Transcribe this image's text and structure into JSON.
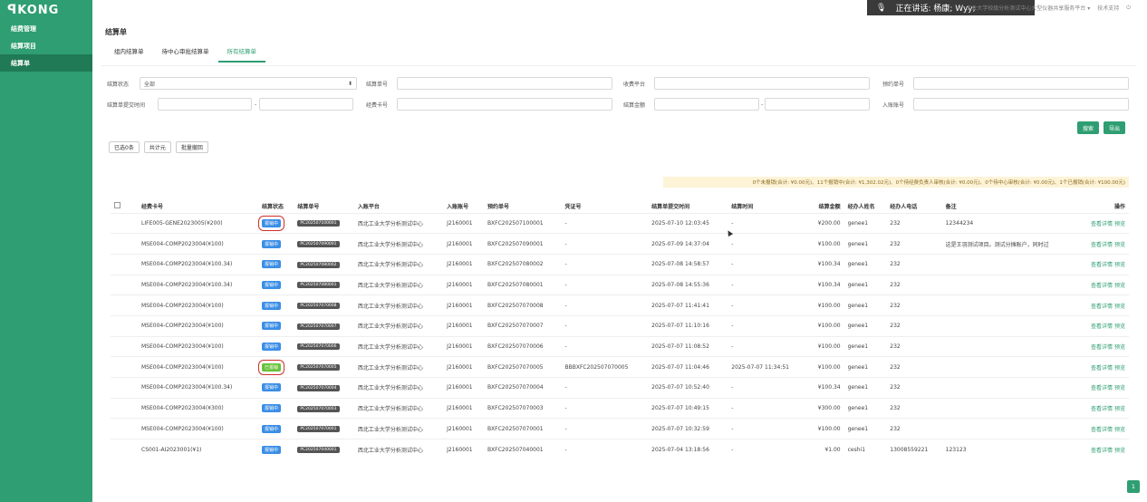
{
  "app": {
    "logo": "KONG"
  },
  "sidebar": {
    "items": [
      {
        "label": "结费管理"
      },
      {
        "label": "结算项目"
      },
      {
        "label": "结算单"
      }
    ]
  },
  "topbar": {
    "toast": "正在讲话: 杨康; Wyy;",
    "org": "工业大学校级分析测试中心大型仪器共享服务平台",
    "support": "技术支持"
  },
  "page": {
    "title": "结算单"
  },
  "tabs": [
    {
      "label": "组内结算单"
    },
    {
      "label": "待中心审批结算单"
    },
    {
      "label": "所有结算单"
    }
  ],
  "filters": {
    "status_label": "结算状态",
    "status_value": "全部",
    "bill_no_label": "结算单号",
    "platform_label": "收费平台",
    "booking_no_label": "预约单号",
    "submit_time_label": "结算单提交时间",
    "card_no_label": "经费卡号",
    "amount_label": "结算金额",
    "account_label": "入账账号",
    "range_sep": "-"
  },
  "actions": {
    "search": "搜索",
    "export": "导出",
    "selected": "已选0条",
    "total": "共计元",
    "batch_withdraw": "批量撤回"
  },
  "summary": "0个未报销(合计: ¥0.00元)、11个报销中(合计: ¥1,302.02元)、0个待经费负责人审核(合计: ¥0.00元)、0个待中心审核(合计: ¥0.00元)、1个已报销(合计: ¥100.00元)",
  "table": {
    "headers": [
      "经费卡号",
      "结算状态",
      "结算单号",
      "入账平台",
      "入账账号",
      "预约单号",
      "凭证号",
      "结算单提交时间",
      "结算时间",
      "结算金额",
      "经办人姓名",
      "经办人电话",
      "备注",
      "操作"
    ],
    "rows": [
      {
        "card": "LIFE005-GENE2023005(¥200)",
        "status": "报销中",
        "code": "PC202507100001",
        "platform": "西北工业大学分析测试中心",
        "account": "J2160001",
        "booking": "BXFC202507100001",
        "voucher": "-",
        "submit": "2025-07-10 12:03:45",
        "settle": "-",
        "amount": "¥200.00",
        "handler": "genee1",
        "phone": "232",
        "remark": "12344234",
        "op1": "查看详情",
        "op2": "预览"
      },
      {
        "card": "MSE004-COMP2023004(¥100)",
        "status": "报销中",
        "code": "PC202507090001",
        "platform": "西北工业大学分析测试中心",
        "account": "J2160001",
        "booking": "BXFC202507090001",
        "voucher": "-",
        "submit": "2025-07-09 14:37:04",
        "settle": "-",
        "amount": "¥100.00",
        "handler": "genee1",
        "phone": "232",
        "remark": "这是王羽测试项目。测试分摊账户，同时过",
        "op1": "查看详情",
        "op2": "预览"
      },
      {
        "card": "MSE004-COMP2023004(¥100.34)",
        "status": "报销中",
        "code": "PC202507080002",
        "platform": "西北工业大学分析测试中心",
        "account": "J2160001",
        "booking": "BXFC202507080002",
        "voucher": "-",
        "submit": "2025-07-08 14:58:57",
        "settle": "-",
        "amount": "¥100.34",
        "handler": "genee1",
        "phone": "232",
        "remark": "",
        "op1": "查看详情",
        "op2": "预览"
      },
      {
        "card": "MSE004-COMP2023004(¥100.34)",
        "status": "报销中",
        "code": "PC202507080001",
        "platform": "西北工业大学分析测试中心",
        "account": "J2160001",
        "booking": "BXFC202507080001",
        "voucher": "-",
        "submit": "2025-07-08 14:55:36",
        "settle": "-",
        "amount": "¥100.34",
        "handler": "genee1",
        "phone": "232",
        "remark": "",
        "op1": "查看详情",
        "op2": "预览"
      },
      {
        "card": "MSE004-COMP2023004(¥100)",
        "status": "报销中",
        "code": "PC202507070008",
        "platform": "西北工业大学分析测试中心",
        "account": "J2160001",
        "booking": "BXFC202507070008",
        "voucher": "-",
        "submit": "2025-07-07 11:41:41",
        "settle": "-",
        "amount": "¥100.00",
        "handler": "genee1",
        "phone": "232",
        "remark": "",
        "op1": "查看详情",
        "op2": "预览"
      },
      {
        "card": "MSE004-COMP2023004(¥100)",
        "status": "报销中",
        "code": "PC202507070007",
        "platform": "西北工业大学分析测试中心",
        "account": "J2160001",
        "booking": "BXFC202507070007",
        "voucher": "-",
        "submit": "2025-07-07 11:10:16",
        "settle": "-",
        "amount": "¥100.00",
        "handler": "genee1",
        "phone": "232",
        "remark": "",
        "op1": "查看详情",
        "op2": "预览"
      },
      {
        "card": "MSE004-COMP2023004(¥100)",
        "status": "报销中",
        "code": "PC202507070006",
        "platform": "西北工业大学分析测试中心",
        "account": "J2160001",
        "booking": "BXFC202507070006",
        "voucher": "-",
        "submit": "2025-07-07 11:08:52",
        "settle": "-",
        "amount": "¥100.00",
        "handler": "genee1",
        "phone": "232",
        "remark": "",
        "op1": "查看详情",
        "op2": "预览"
      },
      {
        "card": "MSE004-COMP2023004(¥100)",
        "status": "已报销",
        "code": "PC202507070005",
        "platform": "西北工业大学分析测试中心",
        "account": "J2160001",
        "booking": "BXFC202507070005",
        "voucher": "BBBXFC202507070005",
        "submit": "2025-07-07 11:04:46",
        "settle": "2025-07-07 11:34:51",
        "amount": "¥100.00",
        "handler": "genee1",
        "phone": "232",
        "remark": "",
        "op1": "查看详情",
        "op2": "预览"
      },
      {
        "card": "MSE004-COMP2023004(¥100.34)",
        "status": "报销中",
        "code": "PC202507070004",
        "platform": "西北工业大学分析测试中心",
        "account": "J2160001",
        "booking": "BXFC202507070004",
        "voucher": "-",
        "submit": "2025-07-07 10:52:40",
        "settle": "-",
        "amount": "¥100.34",
        "handler": "genee1",
        "phone": "232",
        "remark": "",
        "op1": "查看详情",
        "op2": "预览"
      },
      {
        "card": "MSE004-COMP2023004(¥300)",
        "status": "报销中",
        "code": "PC202507070003",
        "platform": "西北工业大学分析测试中心",
        "account": "J2160001",
        "booking": "BXFC202507070003",
        "voucher": "-",
        "submit": "2025-07-07 10:49:15",
        "settle": "-",
        "amount": "¥300.00",
        "handler": "genee1",
        "phone": "232",
        "remark": "",
        "op1": "查看详情",
        "op2": "预览"
      },
      {
        "card": "MSE004-COMP2023004(¥100)",
        "status": "报销中",
        "code": "PC202507070001",
        "platform": "西北工业大学分析测试中心",
        "account": "J2160001",
        "booking": "BXFC202507070001",
        "voucher": "-",
        "submit": "2025-07-07 10:32:59",
        "settle": "-",
        "amount": "¥100.00",
        "handler": "genee1",
        "phone": "232",
        "remark": "",
        "op1": "查看详情",
        "op2": "预览"
      },
      {
        "card": "CS001-AI2023001(¥1)",
        "status": "报销中",
        "code": "PC202507040001",
        "platform": "西北工业大学分析测试中心",
        "account": "J2160001",
        "booking": "BXFC202507040001",
        "voucher": "-",
        "submit": "2025-07-04 13:18:56",
        "settle": "-",
        "amount": "¥1.00",
        "handler": "ceshi1",
        "phone": "13008559221",
        "remark": "123123",
        "op1": "查看详情",
        "op2": "预览"
      }
    ]
  },
  "pager": {
    "current": "1"
  },
  "colors": {
    "brand": "#2f9e72",
    "badge_blue": "#3a8ee6",
    "badge_green": "#67c23a"
  }
}
